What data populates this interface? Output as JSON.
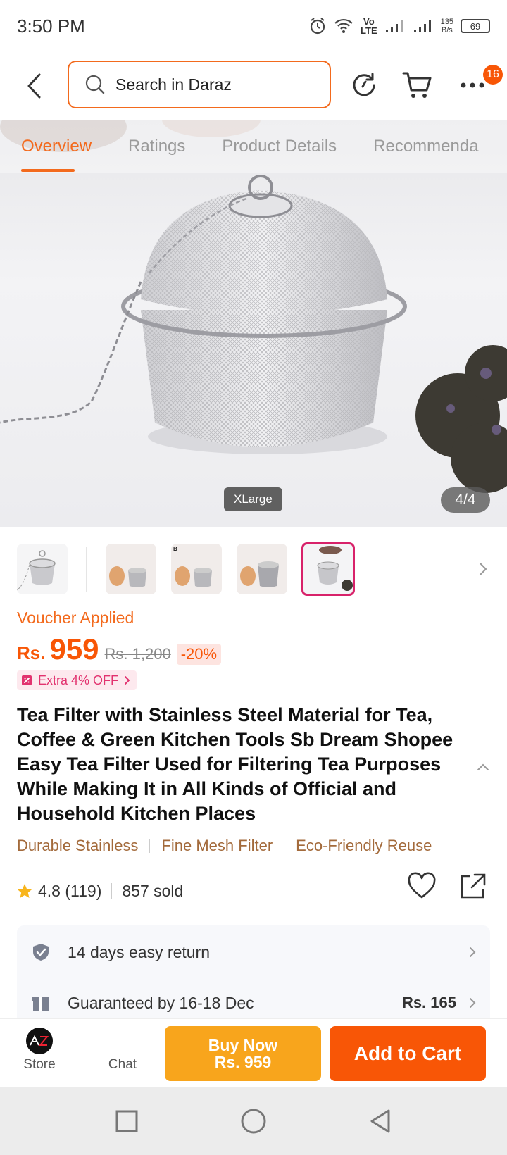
{
  "status_bar": {
    "time": "3:50 PM",
    "volte_top": "Vo",
    "volte_bottom": "LTE",
    "net_speed_value": "135",
    "net_speed_unit": "B/s",
    "battery": "69"
  },
  "header": {
    "search_placeholder": "Search in Daraz",
    "cart_badge": "16"
  },
  "tabs": [
    {
      "label": "Overview",
      "active": true
    },
    {
      "label": "Ratings",
      "active": false
    },
    {
      "label": "Product Details",
      "active": false
    },
    {
      "label": "Recommenda",
      "active": false
    }
  ],
  "gallery": {
    "variant": "XLarge",
    "counter": "4/4",
    "selected_index": 4
  },
  "price": {
    "voucher_label": "Voucher Applied",
    "currency": "Rs.",
    "current": "959",
    "original": "Rs. 1,200",
    "discount": "-20%",
    "extra_offer": "Extra 4% OFF"
  },
  "product": {
    "title": "Tea Filter with Stainless Steel Material for Tea, Coffee & Green Kitchen Tools Sb Dream Shopee Easy Tea Filter Used for Filtering Tea Purposes While Making It in All Kinds of Official and Household Kitchen Places",
    "features": [
      "Durable Stainless",
      "Fine Mesh Filter",
      "Eco-Friendly Reuse"
    ],
    "rating": "4.8",
    "rating_count": "(119)",
    "sold": "857 sold"
  },
  "services": {
    "return": "14 days easy return",
    "delivery": "Guaranteed by 16-18 Dec",
    "delivery_fee": "Rs. 165"
  },
  "bottom_bar": {
    "store_label": "Store",
    "chat_label": "Chat",
    "buy_now_label": "Buy Now",
    "buy_now_price": "Rs. 959",
    "add_to_cart_label": "Add to Cart"
  },
  "colors": {
    "accent_orange": "#f85606",
    "buy_now_yellow": "#f8a51c",
    "feature_brown": "#a36a3b",
    "voucher_pink": "#e2336f"
  }
}
